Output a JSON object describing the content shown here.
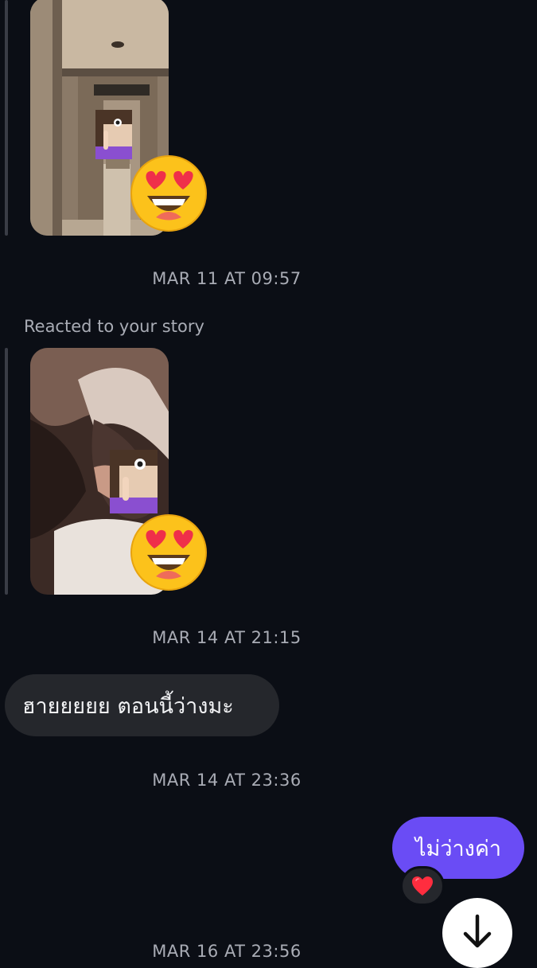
{
  "messages": {
    "timestamps": [
      "MAR 11 AT 09:57",
      "MAR 14 AT 21:15",
      "MAR 14 AT 23:36",
      "MAR 16 AT 23:56"
    ],
    "story_reaction_label": "Reacted to your story",
    "incoming_text": "ฮายยยยย ตอนนี้ว่างมะ",
    "outgoing_text": "ไม่ว่างค่า"
  },
  "icons": {
    "story_reaction": "heart-eyes-emoji",
    "censor_sticker": "face-with-finger-emoji",
    "message_reaction": "red-heart-emoji",
    "scroll_button": "arrow-down-icon"
  },
  "colors": {
    "background": "#0b0e15",
    "incoming_bubble": "#25272c",
    "outgoing_bubble": "#6a4cf5",
    "timestamp_text": "#a9acb5"
  }
}
